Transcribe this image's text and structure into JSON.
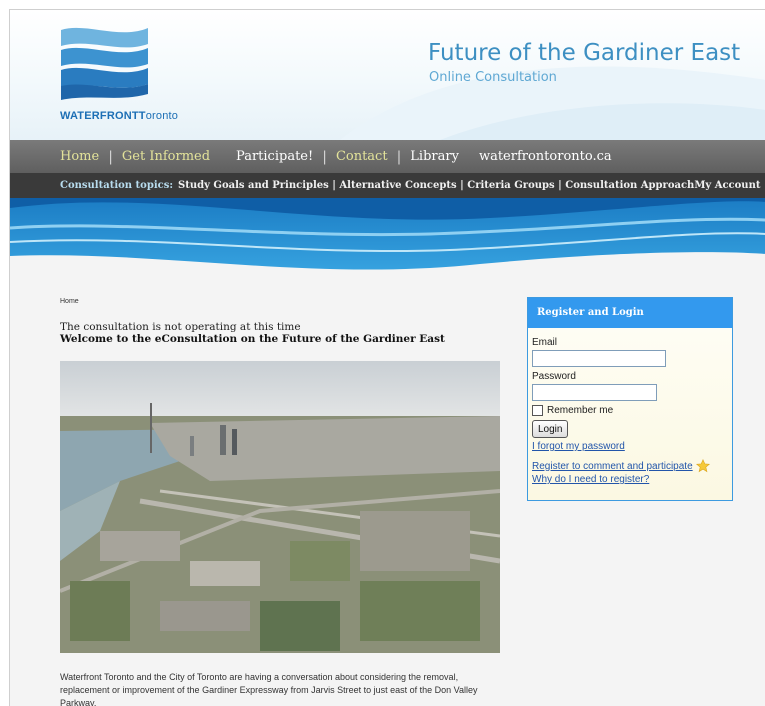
{
  "header": {
    "logo_text_bold": "WATERFRONT",
    "logo_text_light": "oronto",
    "logo_text_t": "T",
    "title": "Future of the Gardiner East",
    "subtitle": "Online Consultation"
  },
  "nav": {
    "items": [
      {
        "label": "Home",
        "color": "#e3e39a"
      },
      {
        "label": "Get Informed",
        "color": "#e3e39a"
      },
      {
        "label": "Participate!",
        "color": "#ffffff"
      },
      {
        "label": "Contact",
        "color": "#e3e39a"
      },
      {
        "label": "Library",
        "color": "#ffffff"
      },
      {
        "label": "waterfrontoronto.ca",
        "color": "#ffffff"
      }
    ]
  },
  "topics": {
    "label": "Consultation topics:",
    "items": [
      "Study Goals and Principles",
      "Alternative Concepts",
      "Criteria Groups",
      "Consultation Approach"
    ],
    "my_account": "My Account"
  },
  "content": {
    "breadcrumb": "Home",
    "notice": "The consultation is not operating at this time",
    "welcome": "Welcome to the eConsultation on the Future of the Gardiner East",
    "intro": "Waterfront Toronto and the City of Toronto are having a conversation about considering the removal, replacement or improvement of the Gardiner Expressway from Jarvis Street to just east of the Don Valley Parkway."
  },
  "login": {
    "heading": "Register and Login",
    "email_label": "Email",
    "email_value": "",
    "password_label": "Password",
    "password_value": "",
    "remember_label": "Remember me",
    "login_button": "Login",
    "forgot_link": "I forgot my password",
    "register_link": "Register to comment and participate",
    "why_link": "Why do I need to register?"
  },
  "colors": {
    "accent_blue": "#3399ee",
    "nav_yellow": "#e3e39a",
    "title_blue": "#3d8fc2"
  }
}
